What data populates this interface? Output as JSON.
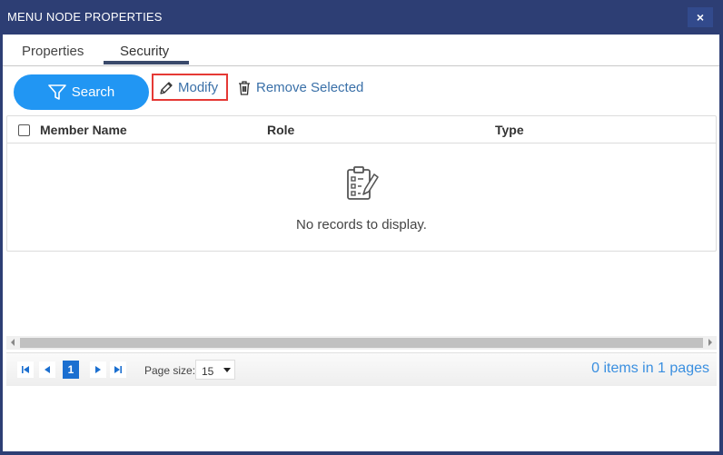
{
  "window": {
    "title": "MENU NODE PROPERTIES",
    "close_label": "×"
  },
  "tabs": [
    {
      "label": "Properties",
      "active": false
    },
    {
      "label": "Security",
      "active": true
    }
  ],
  "toolbar": {
    "search_label": "Search",
    "modify_label": "Modify",
    "remove_label": "Remove Selected",
    "search_icon": "filter-icon",
    "modify_icon": "pencil-icon",
    "remove_icon": "trash-icon"
  },
  "grid": {
    "columns": [
      "Member Name",
      "Role",
      "Type"
    ],
    "rows": [],
    "empty_text": "No records to display.",
    "empty_icon": "clipboard-icon"
  },
  "pager": {
    "current_page": "1",
    "page_size_label": "Page size:",
    "page_size": "15",
    "info": "0 items in 1 pages"
  },
  "colors": {
    "titlebar": "#2d3e74",
    "primary_button": "#2196f3",
    "link": "#3a70a8",
    "highlight_border": "#e53935",
    "active_page": "#1b6fd0"
  }
}
